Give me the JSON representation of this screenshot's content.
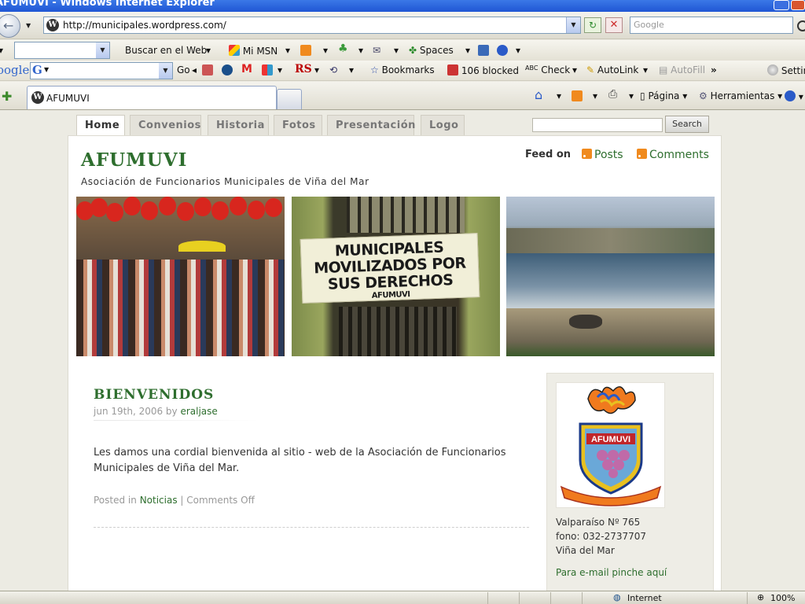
{
  "window": {
    "title": "AFUMUVI - Windows Internet Explorer"
  },
  "address_bar": {
    "url": "http://municipales.wordpress.com/"
  },
  "search_box": {
    "placeholder": "Google"
  },
  "msn_toolbar": {
    "search_label": "Buscar en el Web",
    "mi_msn": "Mi MSN",
    "spaces": "Spaces"
  },
  "google_toolbar": {
    "logo": "oogle",
    "go": "Go",
    "rs": "RS",
    "bookmarks": "Bookmarks",
    "blocked": "106 blocked",
    "check": "Check",
    "autolink": "AutoLink",
    "autofill": "AutoFill",
    "more": "»",
    "settings": "Settin"
  },
  "tabs": {
    "active_label": "AFUMUVI"
  },
  "command_bar": {
    "page": "Página",
    "tools": "Herramientas"
  },
  "site": {
    "nav": [
      "Home",
      "Convenios",
      "Historia",
      "Fotos",
      "Presentación",
      "Logo"
    ],
    "search_button": "Search",
    "title": "AFUMUVI",
    "description": "Asociación de Funcionarios Municipales de Viña del Mar",
    "feed_label": "Feed on",
    "feed_posts": "Posts",
    "feed_comments": "Comments",
    "banner_line1": "MUNICIPALES",
    "banner_line2": "MOVILIZADOS POR",
    "banner_line3": "SUS DERECHOS",
    "banner_sign": "AFUMUVI"
  },
  "post": {
    "title": "BIENVENIDOS",
    "date": "jun 19th, 2006 by ",
    "author": "eraljase",
    "body": "Les damos una cordial bienvenida al sitio - web de la Asociación de Funcionarios Municipales de Viña del Mar.",
    "posted_in": "Posted in ",
    "category": "Noticias",
    "separator": " | ",
    "comments": "Comments Off"
  },
  "sidebar": {
    "logo_text": "AFUMUVI",
    "address": "Valparaíso Nº 765",
    "phone": "fono: 032-2737707",
    "city": "Viña del Mar",
    "email_link": "Para e-mail pinche aquí"
  },
  "status_bar": {
    "zone": "Internet",
    "zoom": "100%"
  },
  "colors": {
    "accent_green": "#2e6e2e",
    "rss_orange": "#f08a1e",
    "xp_blue": "#1f56d4"
  }
}
